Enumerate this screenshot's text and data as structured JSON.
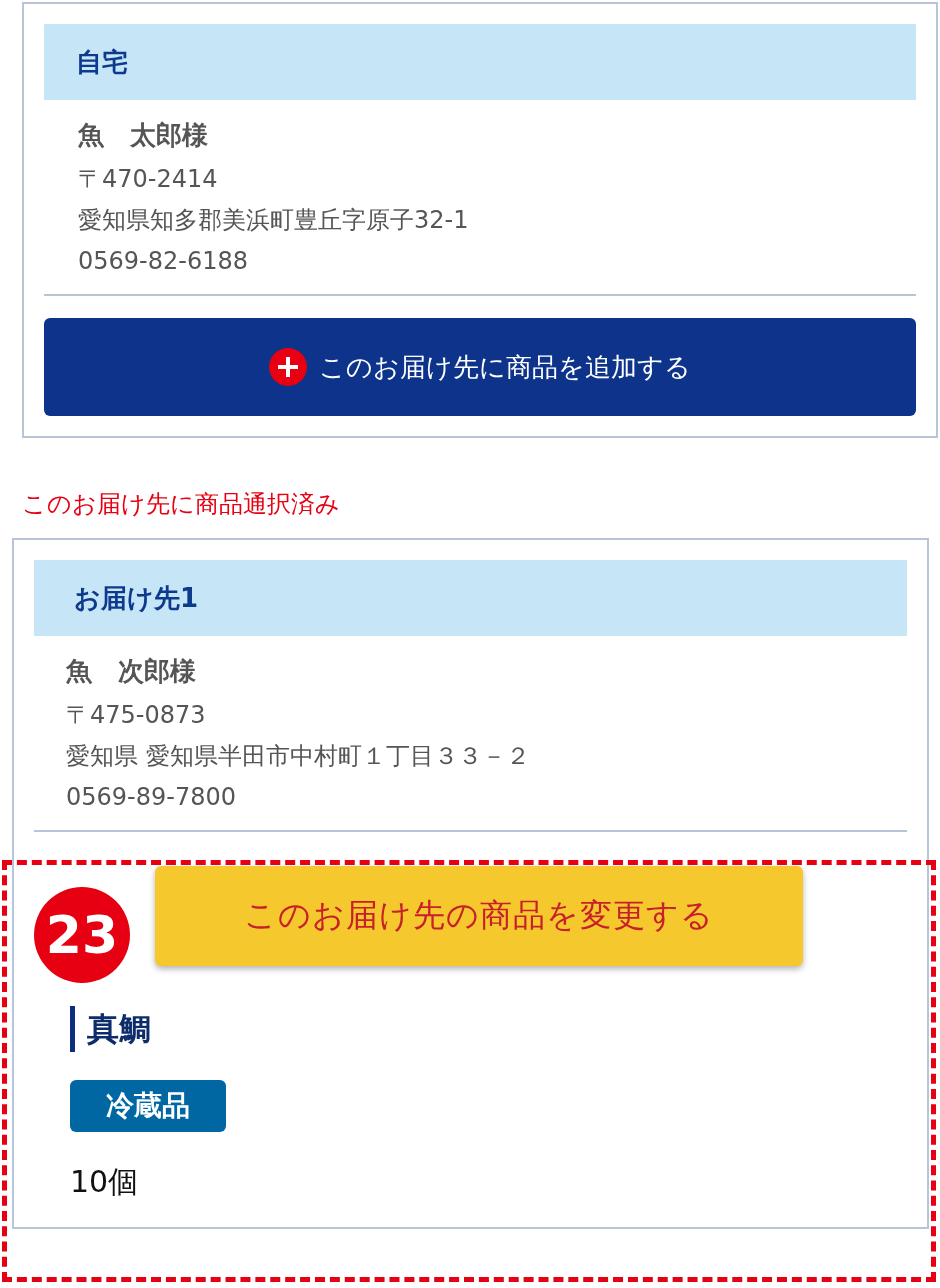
{
  "cards": [
    {
      "title": "自宅",
      "name": "魚　太郎様",
      "postal": "〒470-2414",
      "address": "愛知県知多郡美浜町豊丘字原子32-1",
      "phone": "0569-82-6188",
      "action": {
        "kind": "add",
        "label": "このお届け先に商品を追加する"
      }
    },
    {
      "note": "このお届け先に商品通択済み",
      "title": "お届け先1",
      "name": "魚　次郎様",
      "postal": "〒475-0873",
      "address": "愛知県 愛知県半田市中村町１丁目３３－２",
      "phone": "0569-89-7800",
      "action": {
        "kind": "change",
        "label": "このお届け先の商品を変更する"
      },
      "products": [
        {
          "name": "真鯛",
          "tag": "冷蔵品",
          "quantity": "10個"
        }
      ]
    }
  ],
  "annotation": {
    "number": "23"
  }
}
